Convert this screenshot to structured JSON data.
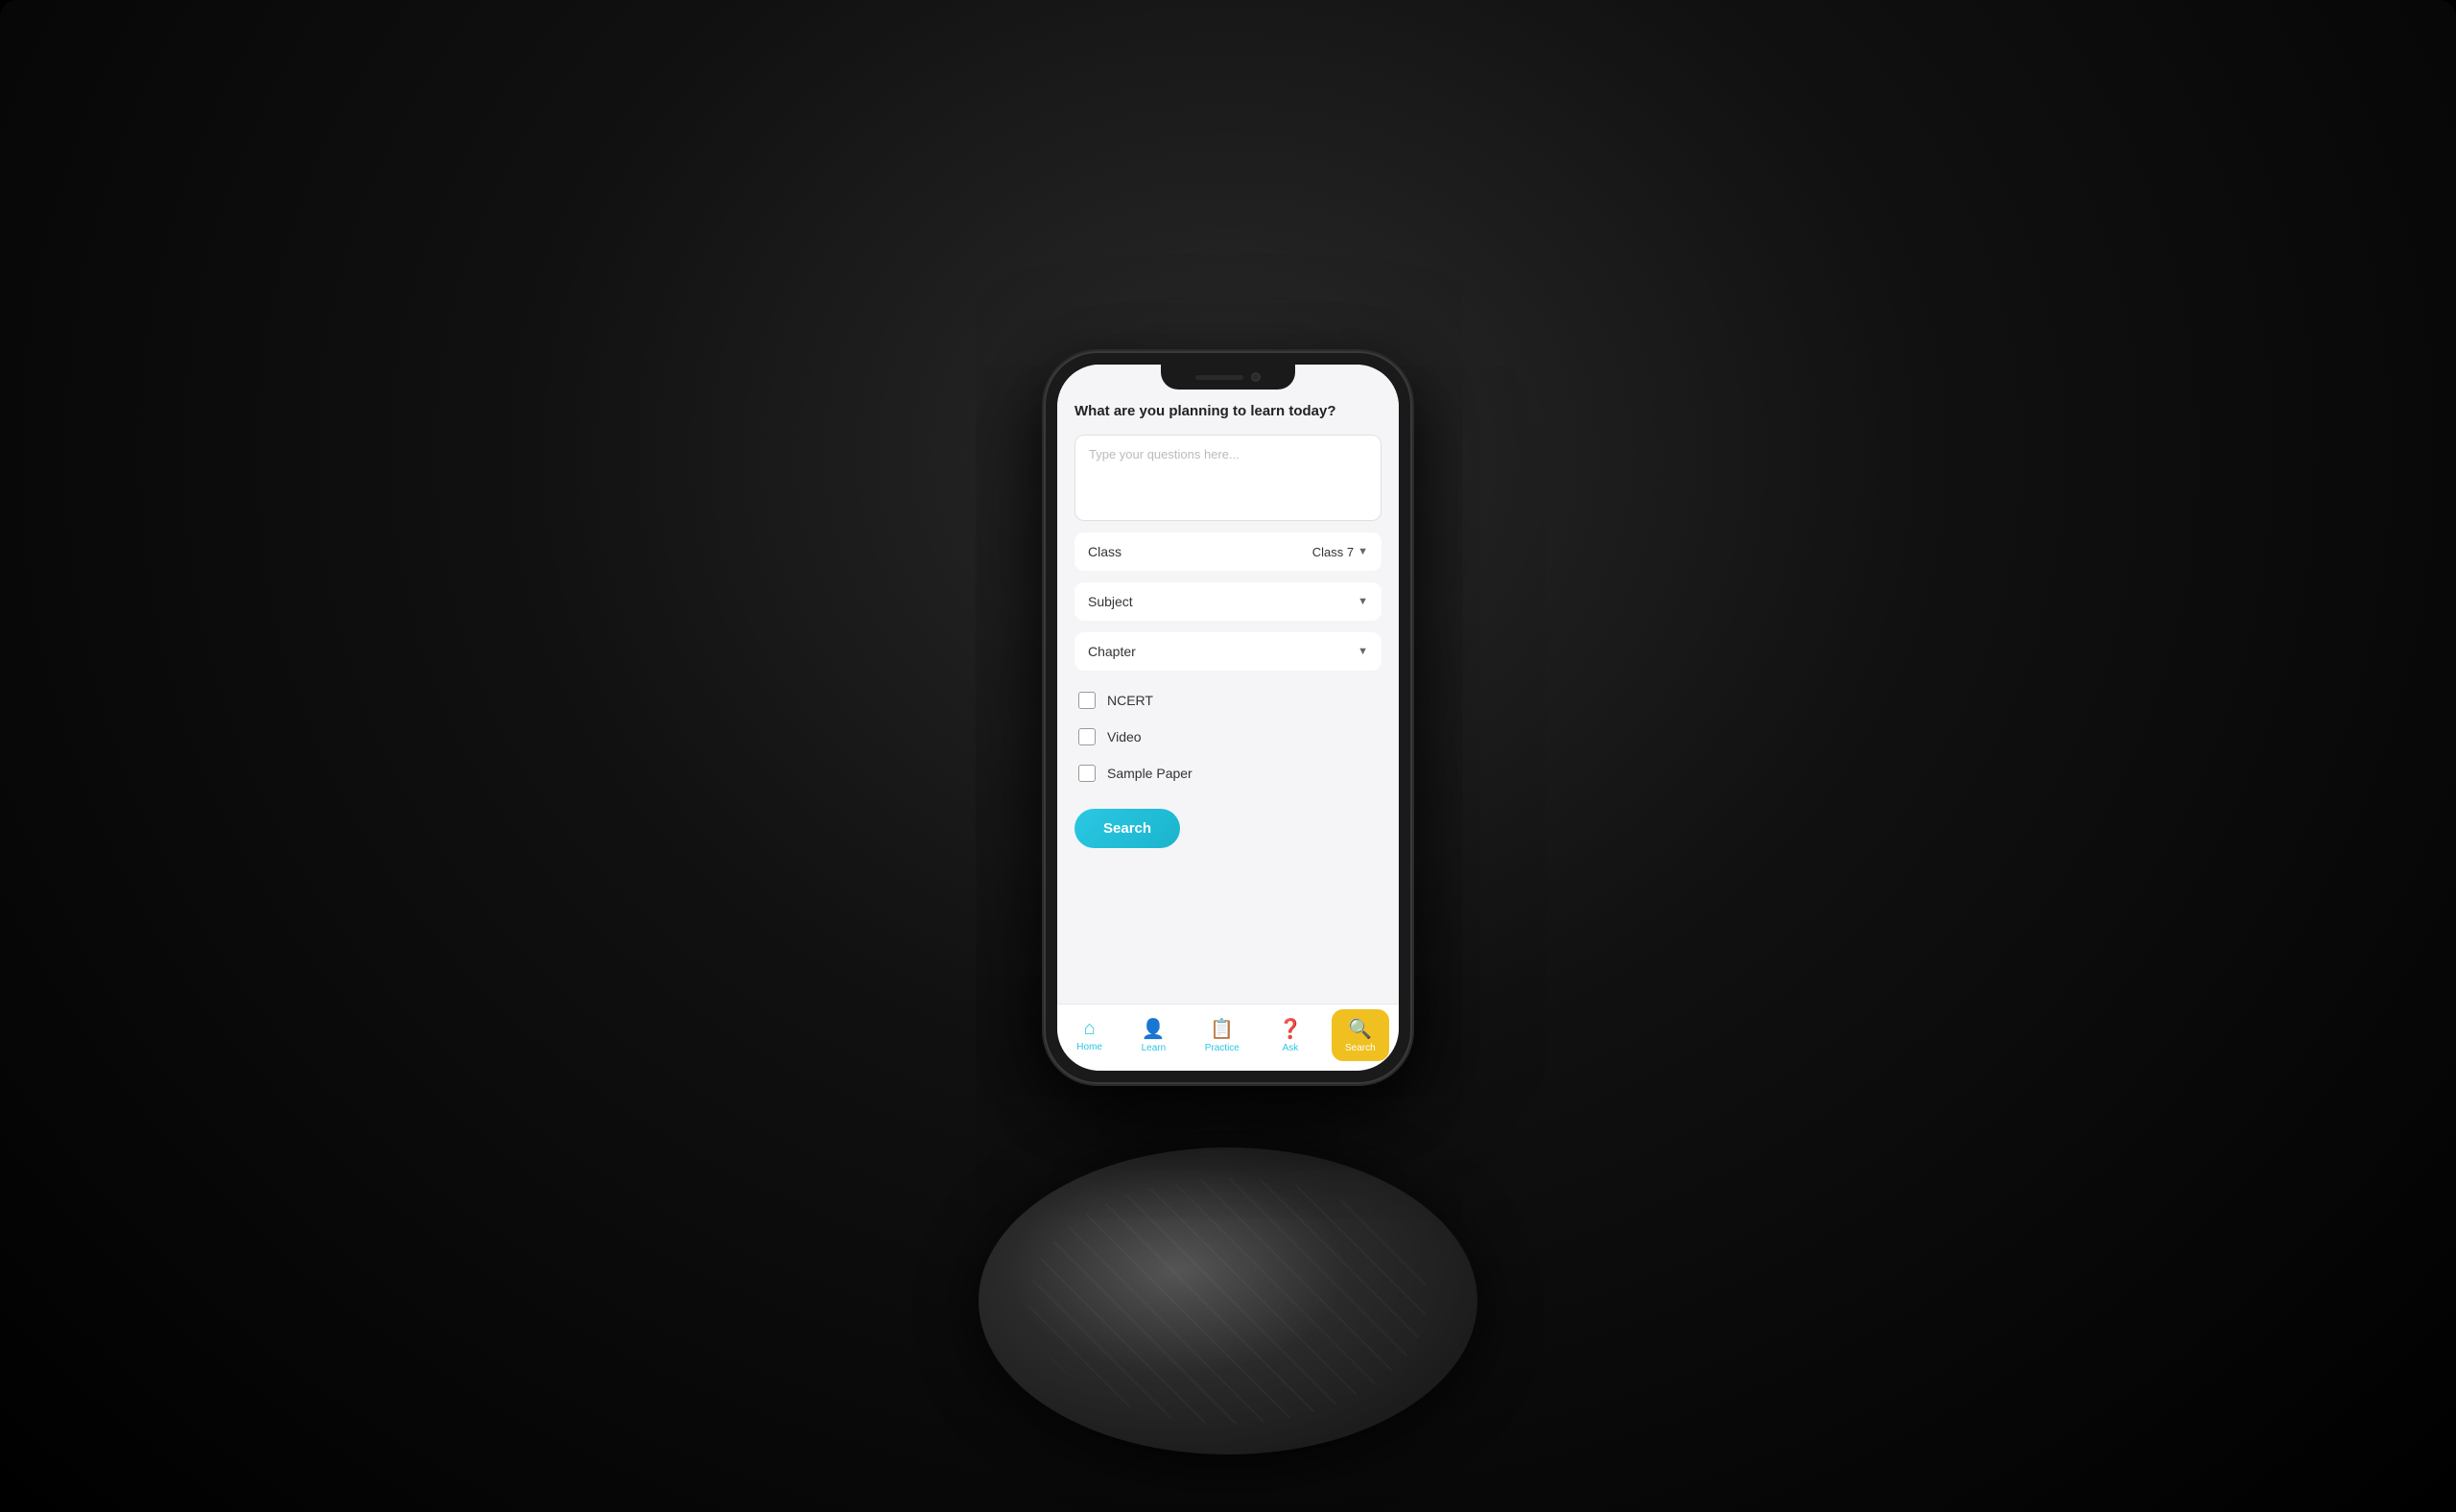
{
  "background": {
    "color": "#000"
  },
  "phone": {
    "screen": {
      "question_label": "What are you planning to learn today?",
      "question_placeholder": "Type your questions here...",
      "class_label": "Class",
      "class_value": "Class 7",
      "subject_label": "Subject",
      "chapter_label": "Chapter",
      "checkboxes": [
        {
          "label": "NCERT",
          "checked": false
        },
        {
          "label": "Video",
          "checked": false
        },
        {
          "label": "Sample Paper",
          "checked": false
        }
      ],
      "search_button": "Search"
    },
    "nav": {
      "items": [
        {
          "label": "Home",
          "icon": "⌂",
          "active": false
        },
        {
          "label": "Learn",
          "icon": "👤",
          "active": false
        },
        {
          "label": "Practice",
          "icon": "📋",
          "active": false
        },
        {
          "label": "Ask",
          "icon": "❓",
          "active": false
        },
        {
          "label": "Search",
          "icon": "🔍",
          "active": true
        }
      ]
    }
  }
}
